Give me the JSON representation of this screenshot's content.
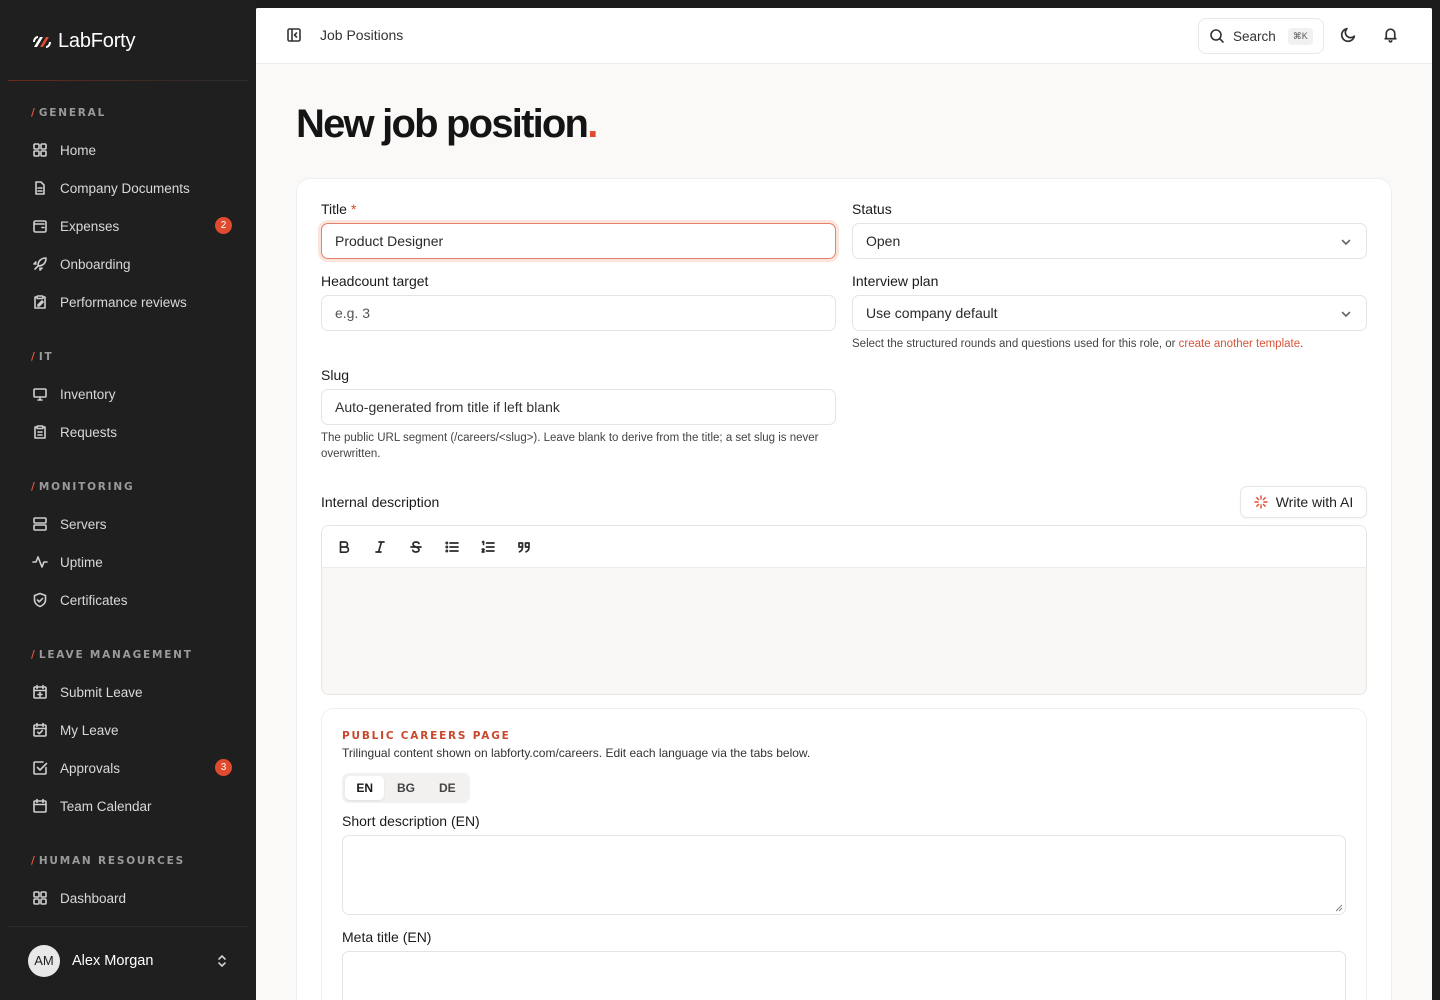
{
  "brand": {
    "name": "LabForty"
  },
  "sidebar": {
    "sections": [
      {
        "label": "GENERAL",
        "items": [
          {
            "label": "Home",
            "icon": "grid-icon"
          },
          {
            "label": "Company Documents",
            "icon": "document-icon"
          },
          {
            "label": "Expenses",
            "icon": "wallet-icon",
            "badge": "2"
          },
          {
            "label": "Onboarding",
            "icon": "rocket-icon"
          },
          {
            "label": "Performance reviews",
            "icon": "clipboard-edit-icon"
          }
        ]
      },
      {
        "label": "IT",
        "items": [
          {
            "label": "Inventory",
            "icon": "monitor-icon"
          },
          {
            "label": "Requests",
            "icon": "clipboard-list-icon"
          }
        ]
      },
      {
        "label": "MONITORING",
        "items": [
          {
            "label": "Servers",
            "icon": "server-icon"
          },
          {
            "label": "Uptime",
            "icon": "activity-icon"
          },
          {
            "label": "Certificates",
            "icon": "shield-check-icon"
          }
        ]
      },
      {
        "label": "LEAVE MANAGEMENT",
        "items": [
          {
            "label": "Submit Leave",
            "icon": "calendar-plus-icon"
          },
          {
            "label": "My Leave",
            "icon": "calendar-check-icon"
          },
          {
            "label": "Approvals",
            "icon": "check-square-icon",
            "badge": "3"
          },
          {
            "label": "Team Calendar",
            "icon": "calendar-icon"
          }
        ]
      },
      {
        "label": "HUMAN RESOURCES",
        "items": [
          {
            "label": "Dashboard",
            "icon": "grid-icon"
          }
        ]
      }
    ]
  },
  "user": {
    "initials": "AM",
    "name": "Alex Morgan"
  },
  "topbar": {
    "breadcrumb": "Job Positions",
    "search_label": "Search",
    "search_shortcut": "⌘K"
  },
  "page": {
    "title": "New job position",
    "title_dot": "."
  },
  "form": {
    "title": {
      "label": "Title",
      "required_mark": "*",
      "value": "Product Designer"
    },
    "status": {
      "label": "Status",
      "value": "Open"
    },
    "headcount": {
      "label": "Headcount target",
      "placeholder": "e.g. 3"
    },
    "interview_plan": {
      "label": "Interview plan",
      "value": "Use company default",
      "help_prefix": "Select the structured rounds and questions used for this role, or ",
      "help_link": "create another template",
      "help_suffix": "."
    },
    "slug": {
      "label": "Slug",
      "placeholder": "Auto-generated from title if left blank",
      "help": "The public URL segment (/careers/<slug>). Leave blank to derive from the title; a set slug is never overwritten."
    },
    "internal_description": {
      "label": "Internal description",
      "ai_button": "Write with AI"
    },
    "careers": {
      "eyebrow": "PUBLIC CAREERS PAGE",
      "description": "Trilingual content shown on labforty.com/careers. Edit each language via the tabs below.",
      "tabs": [
        "EN",
        "BG",
        "DE"
      ],
      "active_tab": "EN",
      "short_description_label": "Short description (EN)",
      "meta_title_label": "Meta title (EN)"
    }
  },
  "colors": {
    "accent": "#e04a2f",
    "sidebar_bg": "#1f1f1f",
    "main_bg": "#faf9f8"
  }
}
